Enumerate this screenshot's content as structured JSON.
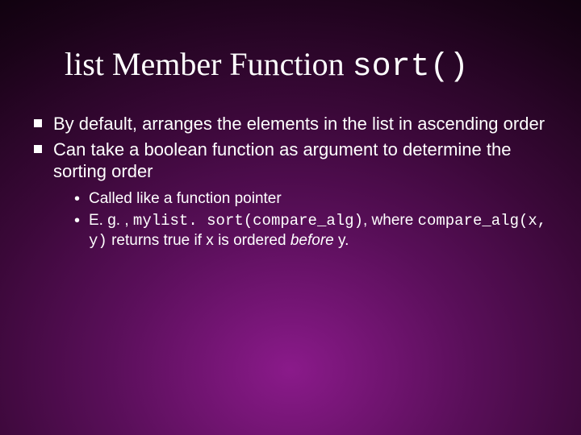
{
  "title_prefix": "list Member Function ",
  "title_code": "sort()",
  "bullets": [
    "By default, arranges the elements in the list in ascending order",
    "Can take a boolean function as argument to determine the sorting order"
  ],
  "sub_bullets": {
    "item0": "Called like a function pointer",
    "item1_prefix": "E. g. , ",
    "item1_code1": "mylist. sort(compare_alg)",
    "item1_mid": ", where ",
    "item1_code2": "compare_alg(x, y)",
    "item1_tail1": " returns true if x is ordered ",
    "item1_italic": "before",
    "item1_tail2": " y."
  }
}
